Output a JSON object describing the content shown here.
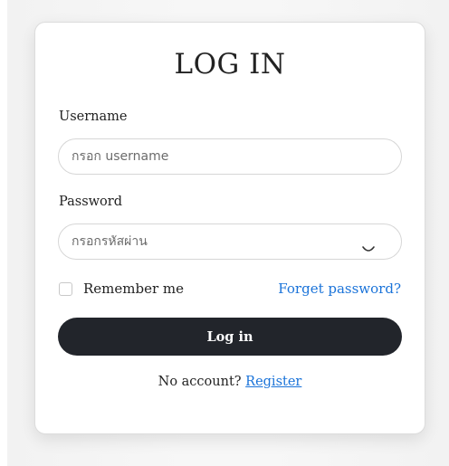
{
  "form": {
    "title": "LOG IN",
    "username": {
      "label": "Username",
      "placeholder": "กรอก username",
      "value": ""
    },
    "password": {
      "label": "Password",
      "placeholder": "กรอกรหัสผ่าน",
      "value": "",
      "toggle_icon": "eye-closed-icon"
    },
    "remember": {
      "label": "Remember me",
      "checked": false
    },
    "forgot_label": "Forget password?",
    "submit_label": "Log in",
    "register": {
      "prompt": "No account?",
      "link_label": "Register"
    }
  },
  "colors": {
    "primary_button": "#22252b",
    "link": "#1a73d9"
  }
}
